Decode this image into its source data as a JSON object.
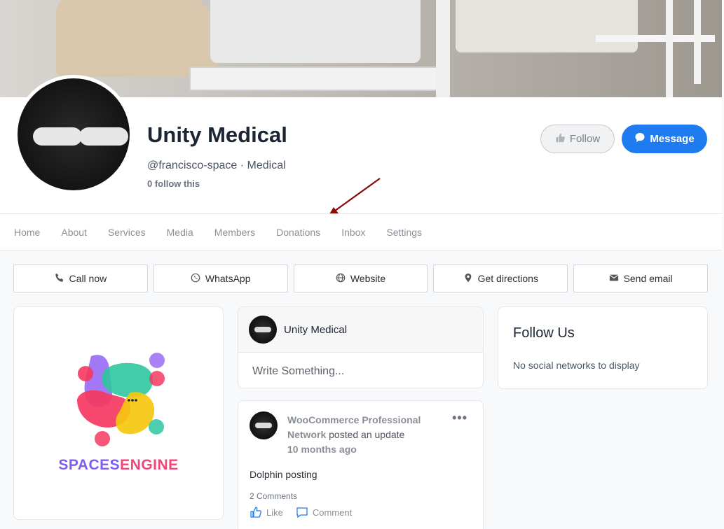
{
  "profile": {
    "name": "Unity Medical",
    "handle": "@francisco-space · Medical",
    "followers": "0 follow this",
    "follow_label": "Follow",
    "message_label": "Message"
  },
  "nav": {
    "items": [
      "Home",
      "About",
      "Services",
      "Media",
      "Members",
      "Donations",
      "Inbox",
      "Settings"
    ]
  },
  "actions": {
    "call": "Call now",
    "whatsapp": "WhatsApp",
    "website": "Website",
    "directions": "Get directions",
    "email": "Send email"
  },
  "logo": {
    "word1": "SPACES",
    "word2": "ENGINE"
  },
  "composer": {
    "name": "Unity Medical",
    "placeholder": "Write Something..."
  },
  "follow_us": {
    "title": "Follow Us",
    "empty": "No social networks to display"
  },
  "post": {
    "author": "WooCommerce Professional Network",
    "action": "posted an update",
    "time": "10 months ago",
    "more": "•••",
    "body": "Dolphin posting",
    "comments": "2 Comments",
    "like": "Like",
    "comment": "Comment"
  },
  "colors": {
    "primary": "#1f7cf0",
    "logo_purple": "#7d5cf0",
    "logo_pink": "#f0457a",
    "arrow": "#8b0a0a"
  }
}
